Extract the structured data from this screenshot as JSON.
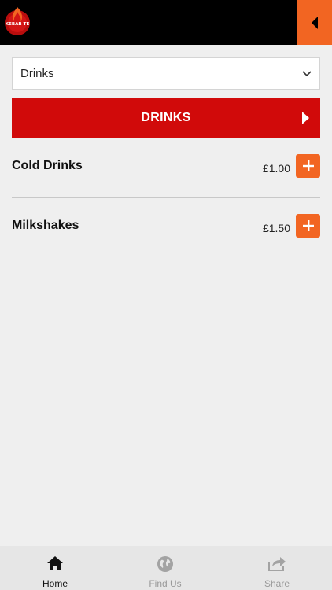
{
  "header": {
    "logo_text": "KEBAB TE",
    "back_icon": "chevron-left-icon"
  },
  "category_select": {
    "selected": "Drinks"
  },
  "category_banner": {
    "title": "DRINKS"
  },
  "items": [
    {
      "name": "Cold Drinks",
      "price": "£1.00"
    },
    {
      "name": "Milkshakes",
      "price": "£1.50"
    }
  ],
  "tabs": [
    {
      "label": "Home",
      "icon": "home-icon",
      "active": true
    },
    {
      "label": "Find Us",
      "icon": "globe-icon",
      "active": false
    },
    {
      "label": "Share",
      "icon": "share-icon",
      "active": false
    }
  ],
  "colors": {
    "accent": "#f26522",
    "banner": "#d10a0a",
    "topbar": "#000000"
  }
}
